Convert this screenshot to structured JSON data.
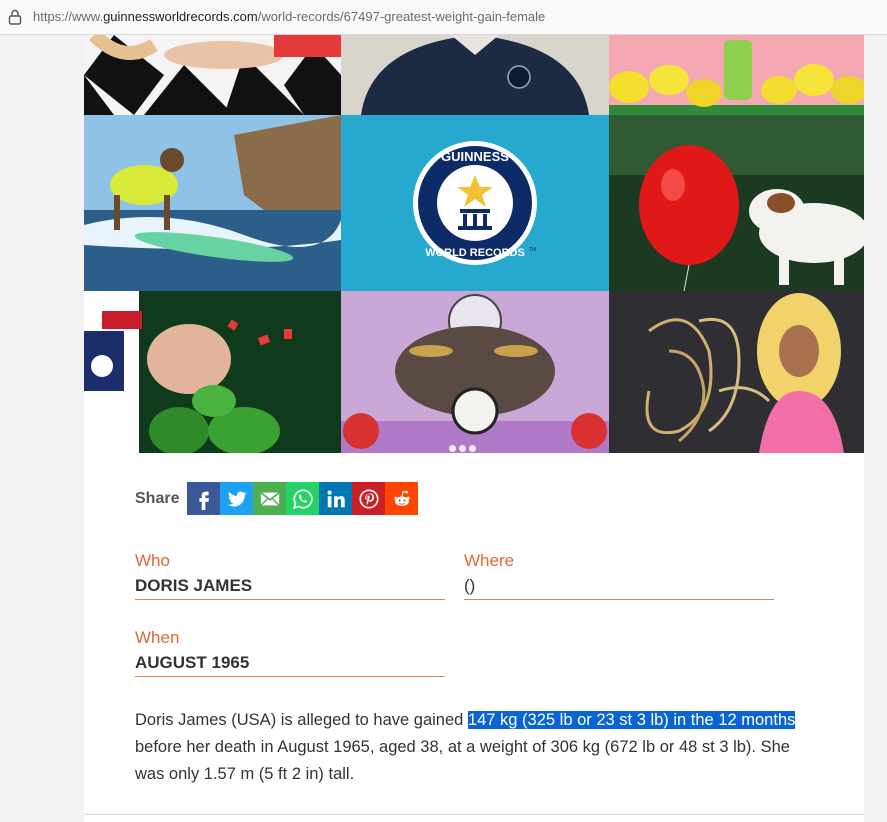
{
  "browser": {
    "url_prefix": "https://www.",
    "url_domain": "guinnessworldrecords.com",
    "url_path": "/world-records/67497-greatest-weight-gain-female"
  },
  "hero": {
    "logo_text_top": "GUINNESS",
    "logo_text_bottom": "WORLD RECORDS",
    "logo_tm": "TM"
  },
  "share": {
    "label": "Share",
    "buttons": [
      {
        "name": "facebook",
        "color": "#3b5998"
      },
      {
        "name": "twitter",
        "color": "#1da1f2"
      },
      {
        "name": "email",
        "color": "#4caf50"
      },
      {
        "name": "whatsapp",
        "color": "#25d366"
      },
      {
        "name": "linkedin",
        "color": "#0077b5"
      },
      {
        "name": "pinterest",
        "color": "#cb2027"
      },
      {
        "name": "reddit",
        "color": "#ff4500"
      }
    ]
  },
  "record": {
    "who_label": "Who",
    "who_value": "DORIS JAMES",
    "where_label": "Where",
    "where_value": "()",
    "when_label": "When",
    "when_value": "AUGUST 1965"
  },
  "description": {
    "before": "Doris James (USA) is alleged to have gained ",
    "highlight": "147 kg (325 lb or 23 st 3 lb) in the 12 months",
    "after": " before her death in August 1965, aged 38, at a weight of 306 kg (672 lb or 48 st 3 lb). She was only 1.57 m (5 ft 2 in) tall."
  },
  "colors": {
    "accent_orange": "#e2673a",
    "highlight_blue": "#0a64d6"
  }
}
